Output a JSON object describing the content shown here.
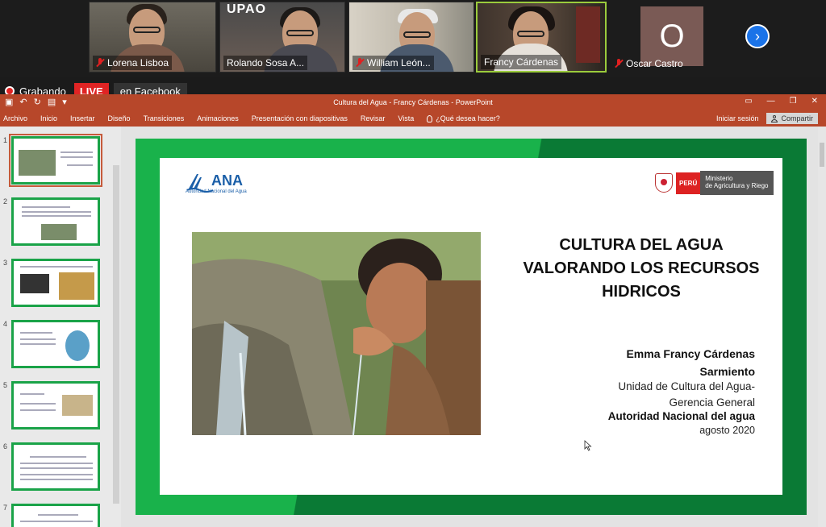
{
  "meeting": {
    "participants": [
      {
        "name": "Lorena Lisboa"
      },
      {
        "name": "Rolando Sosa A..."
      },
      {
        "name": "William León..."
      },
      {
        "name": "Francy Cárdenas"
      },
      {
        "name": "Oscar Castro",
        "avatar_letter": "O"
      }
    ],
    "tile_logo": "UPAO",
    "next_icon": "chevron-right-icon"
  },
  "recording": {
    "status": "Grabando",
    "live_badge": "LIVE",
    "destination": "en Facebook"
  },
  "powerpoint": {
    "window_title": "Cultura del Agua - Francy Cárdenas - PowerPoint",
    "ribbon_tabs": [
      "Archivo",
      "Inicio",
      "Insertar",
      "Diseño",
      "Transiciones",
      "Animaciones",
      "Presentación con diapositivas",
      "Revisar",
      "Vista"
    ],
    "tell_me": "¿Qué desea hacer?",
    "sign_in": "Iniciar sesión",
    "share": "Compartir",
    "thumbnail_numbers": [
      "1",
      "2",
      "3",
      "4",
      "5",
      "6",
      "7"
    ],
    "selected_slide": 1,
    "brand_color": "#b7472a"
  },
  "slide": {
    "ana_logo": "ANA",
    "ana_full": "Autoridad Nacional del Agua",
    "peru": "PERÚ",
    "ministry_line1": "Ministerio",
    "ministry_line2": "de Agricultura y Riego",
    "title_line1": "CULTURA DEL AGUA",
    "title_line2": "VALORANDO LOS RECURSOS",
    "title_line3": "HIDRICOS",
    "author_line1": "Emma Francy Cárdenas",
    "author_line2": "Sarmiento",
    "unit_line1": "Unidad de Cultura del Agua-",
    "unit_line2": "Gerencia General",
    "organization": "Autoridad Nacional del agua",
    "date": "agosto 2020",
    "green_light": "#19b24b",
    "green_dark": "#0a7a35"
  }
}
